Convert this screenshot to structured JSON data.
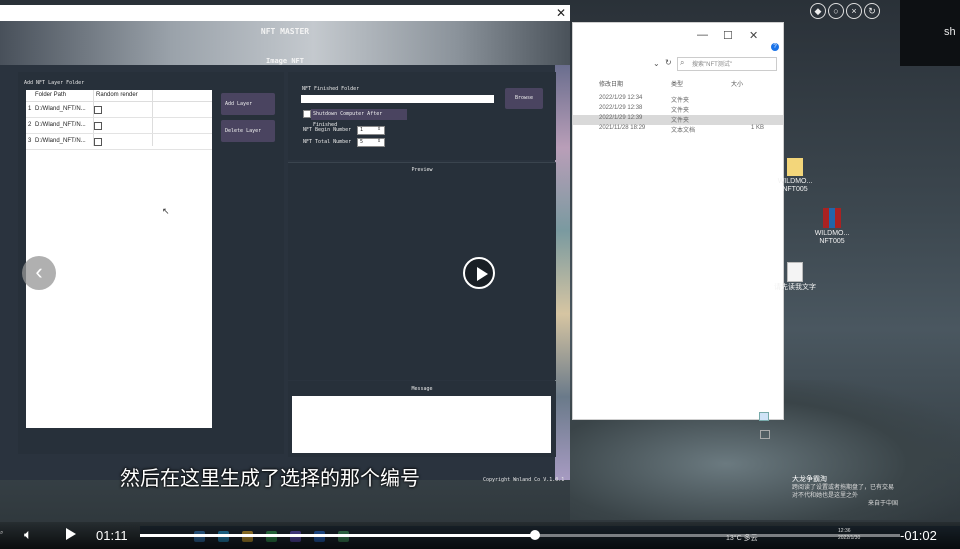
{
  "player": {
    "current_time": "01:11",
    "remaining_time": "-01:02",
    "progress_percent": 52,
    "subtitle": "然后在这里生成了选择的那个编号",
    "volume_icon": "volume-icon",
    "play_icon": "play-icon",
    "prev_icon": "chevron-left-icon"
  },
  "desktop": {
    "user_text": "sh",
    "icons": [
      {
        "label": "WILDMO... NFT005",
        "icon": "folder-icon"
      },
      {
        "label": "WILDMO... NFT005",
        "icon": "archive-icon"
      },
      {
        "label": "请先读我文字",
        "icon": "document-icon"
      }
    ],
    "notification": {
      "title": "大龙争霸淘",
      "body": "跨阅读了设置或者拖期盘了，已有交易对不代和她也是这里之外",
      "source": "来自于中国"
    }
  },
  "explorer": {
    "search_placeholder": "搜索\"NFT测试\"",
    "columns": [
      "修改日期",
      "类型",
      "大小"
    ],
    "rows": [
      {
        "date": "2022/1/29 12:34",
        "type": "文件夹",
        "size": "",
        "selected": false
      },
      {
        "date": "2022/1/29 12:38",
        "type": "文件夹",
        "size": "",
        "selected": false
      },
      {
        "date": "2022/1/29 12:39",
        "type": "文件夹",
        "size": "",
        "selected": true
      },
      {
        "date": "2021/11/28 18:29",
        "type": "文本文档",
        "size": "1 KB",
        "selected": false
      }
    ]
  },
  "app": {
    "title": "NFT MASTER",
    "subtitle": "Image NFT",
    "left_label": "Add NFT Layer Folder",
    "table": {
      "headers": [
        "Folder Path",
        "Random render"
      ],
      "rows": [
        {
          "index": "1",
          "path": "D:/Wland_NFT/N..."
        },
        {
          "index": "2",
          "path": "D:/Wland_NFT/N..."
        },
        {
          "index": "3",
          "path": "D:/Wland_NFT/N..."
        }
      ]
    },
    "buttons": {
      "add_layer": "Add Layer",
      "delete_layer": "Delete Layer",
      "browse": "Browse"
    },
    "finished_folder_label": "NFT Finished Folder",
    "finished_folder_value": "",
    "shutdown_label": "Shutdown Computer After Finished",
    "begin_number_label": "NFT Begin Number",
    "begin_number_value": "1",
    "total_number_label": "NFT Total Number",
    "total_number_value": "5",
    "preview_label": "Preview",
    "message_label": "Message",
    "copyright": "Copyright Wnland Co V.1.0.1"
  },
  "taskbar": {
    "weather": "13°C 多云",
    "time": "12:36",
    "date": "2022/1/30"
  }
}
